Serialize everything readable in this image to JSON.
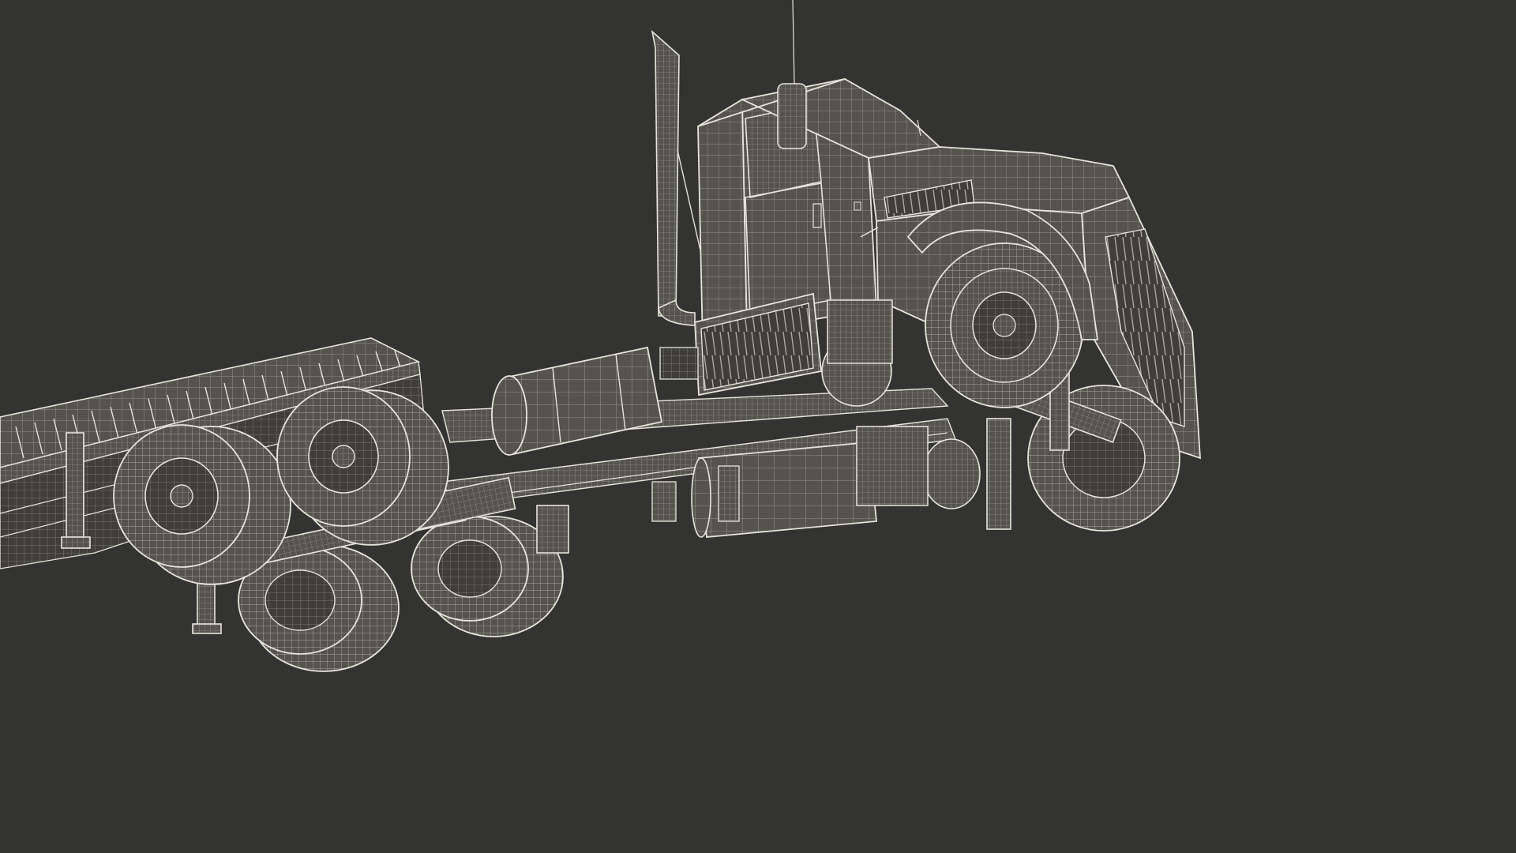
{
  "background": "#333331",
  "wire": "#e6e4da",
  "wireDim": "#a9a79e",
  "surface": "#54534e",
  "surfaceLight": "#6e6d67",
  "surfaceDark": "#3f3e3a"
}
